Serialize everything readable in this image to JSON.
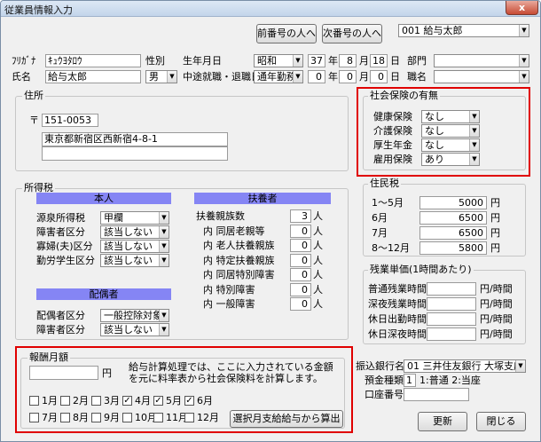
{
  "window": {
    "title": "従業員情報入力",
    "close": "x"
  },
  "top": {
    "prev_btn": "前番号の人へ",
    "next_btn": "次番号の人へ",
    "employee_select": "001 給与太郎"
  },
  "personal": {
    "furigana_label": "ﾌﾘｶﾞﾅ",
    "furigana_value": "ｷｭｳﾖﾀﾛｳ",
    "name_label": "氏名",
    "name_value": "給与太郎",
    "sex_label": "性別",
    "sex_value": "男",
    "birth_label": "生年月日",
    "birth_era": "昭和",
    "birth_year": "37",
    "birth_month": "8",
    "birth_day": "18",
    "year_unit": "年",
    "month_unit": "月",
    "day_unit": "日",
    "midjob_label": "中途就職・退職日",
    "midjob_select": "通年勤務",
    "midjob_year": "0",
    "midjob_month": "0",
    "midjob_day": "0",
    "dept_label": "部門",
    "dept_value": "",
    "title_label": "職名",
    "title_value": ""
  },
  "address": {
    "group_title": "住所",
    "zip_label": "〒",
    "zip_value": "151-0053",
    "line1": "東京都新宿区西新宿4-8-1",
    "line2": ""
  },
  "insurance": {
    "group_title": "社会保険の有無",
    "rows": [
      {
        "label": "健康保険",
        "value": "なし"
      },
      {
        "label": "介護保険",
        "value": "なし"
      },
      {
        "label": "厚生年金",
        "value": "なし"
      },
      {
        "label": "雇用保険",
        "value": "あり"
      }
    ]
  },
  "income_tax": {
    "group_title": "所得税",
    "self_header": "本人",
    "self_rows": [
      {
        "label": "源泉所得税",
        "value": "甲欄"
      },
      {
        "label": "障害者区分",
        "value": "該当しない"
      },
      {
        "label": "寡婦(夫)区分",
        "value": "該当しない"
      },
      {
        "label": "勤労学生区分",
        "value": "該当しない"
      }
    ],
    "dep_header": "扶養者",
    "person_unit": "人",
    "dep_rows": [
      {
        "label": "扶養親族数",
        "value": "3"
      },
      {
        "label": "内 同居老親等",
        "value": "0"
      },
      {
        "label": "内 老人扶養親族",
        "value": "0"
      },
      {
        "label": "内 特定扶養親族",
        "value": "0"
      },
      {
        "label": "内 同居特別障害",
        "value": "0"
      },
      {
        "label": "内 特別障害",
        "value": "0"
      },
      {
        "label": "内 一般障害",
        "value": "0"
      }
    ],
    "spouse_header": "配偶者",
    "spouse_rows": [
      {
        "label": "配偶者区分",
        "value": "一般控除対象"
      },
      {
        "label": "障害者区分",
        "value": "該当しない"
      }
    ]
  },
  "resident_tax": {
    "group_title": "住民税",
    "unit": "円",
    "rows": [
      {
        "label": "1～5月",
        "value": "5000"
      },
      {
        "label": "6月",
        "value": "6500"
      },
      {
        "label": "7月",
        "value": "6500"
      },
      {
        "label": "8～12月",
        "value": "5800"
      }
    ]
  },
  "overtime": {
    "group_title": "残業単価(1時間あたり)",
    "unit": "円/時間",
    "rows": [
      {
        "label": "普通残業時間",
        "value": ""
      },
      {
        "label": "深夜残業時間",
        "value": ""
      },
      {
        "label": "休日出勤時間",
        "value": ""
      },
      {
        "label": "休日深夜時間",
        "value": ""
      }
    ]
  },
  "remuneration": {
    "group_title": "報酬月額",
    "amount": "",
    "yen": "円",
    "note": "給与計算処理では、ここに入力されている金額を元に料率表から社会保険料を計算します。",
    "months": [
      {
        "label": "1月",
        "checked": false
      },
      {
        "label": "2月",
        "checked": false
      },
      {
        "label": "3月",
        "checked": false
      },
      {
        "label": "4月",
        "checked": true
      },
      {
        "label": "5月",
        "checked": true
      },
      {
        "label": "6月",
        "checked": true
      },
      {
        "label": "7月",
        "checked": false
      },
      {
        "label": "8月",
        "checked": false
      },
      {
        "label": "9月",
        "checked": false
      },
      {
        "label": "10月",
        "checked": false
      },
      {
        "label": "11月",
        "checked": false
      },
      {
        "label": "12月",
        "checked": false
      }
    ],
    "calc_btn": "選択月支給給与から算出",
    "check_mark": "✓"
  },
  "bank": {
    "bank_label": "振込銀行名",
    "bank_value": "01 三井住友銀行 大塚支店",
    "type_label": "預金種類",
    "type_value": "1",
    "type_options": "1:普通 2:当座",
    "acct_label": "口座番号",
    "acct_value": ""
  },
  "footer": {
    "update_btn": "更新",
    "close_btn": "閉じる"
  },
  "colors": {
    "header_bg": "#8585f4",
    "highlight": "#e00000"
  }
}
